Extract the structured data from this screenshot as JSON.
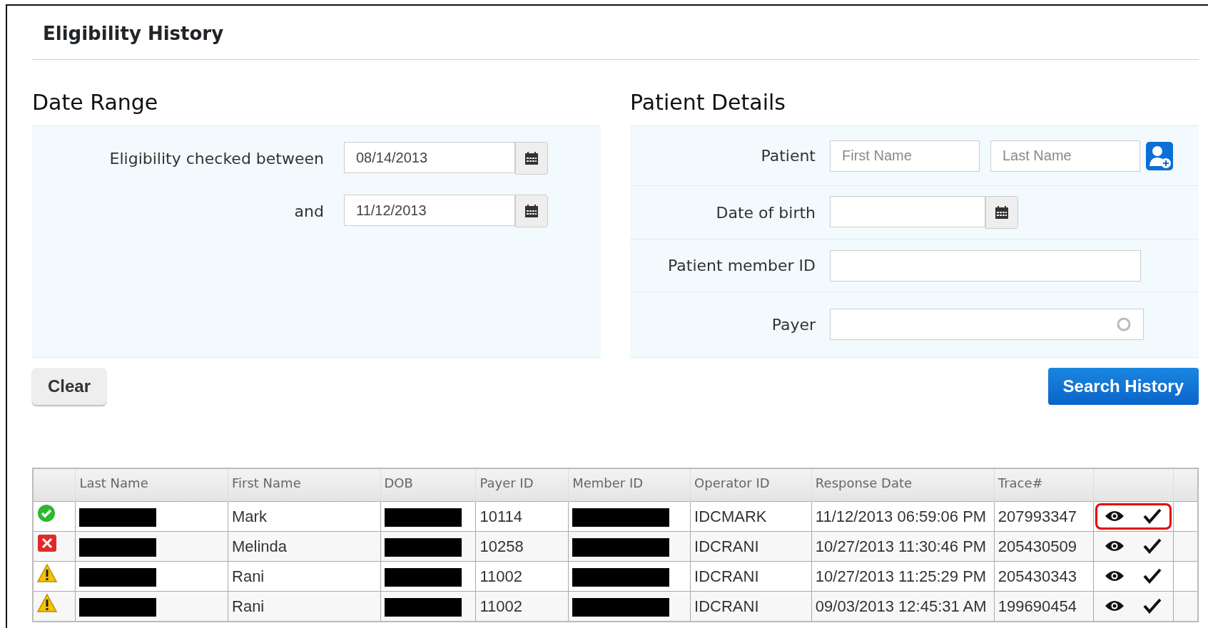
{
  "page": {
    "title": "Eligibility History"
  },
  "date_range": {
    "heading": "Date Range",
    "from_label": "Eligibility checked between",
    "from_value": "08/14/2013",
    "to_label": "and",
    "to_value": "11/12/2013"
  },
  "patient_details": {
    "heading": "Patient Details",
    "patient_label": "Patient",
    "first_name_placeholder": "First Name",
    "last_name_placeholder": "Last Name",
    "dob_label": "Date of birth",
    "member_id_label": "Patient member ID",
    "payer_label": "Payer"
  },
  "buttons": {
    "clear": "Clear",
    "search": "Search History"
  },
  "table": {
    "columns": [
      "Last Name",
      "First Name",
      "DOB",
      "Payer ID",
      "Member ID",
      "Operator ID",
      "Response Date",
      "Trace#"
    ],
    "rows": [
      {
        "kind": "success",
        "first_name": "Mark",
        "payer_id": "10114",
        "operator_id": "IDCMARK",
        "response_date": "11/12/2013 06:59:06 PM",
        "trace": "207993347",
        "highlighted": true
      },
      {
        "kind": "error",
        "first_name": "Melinda",
        "payer_id": "10258",
        "operator_id": "IDCRANI",
        "response_date": "10/27/2013 11:30:46 PM",
        "trace": "205430509",
        "highlighted": false
      },
      {
        "kind": "warning",
        "first_name": "Rani",
        "payer_id": "11002",
        "operator_id": "IDCRANI",
        "response_date": "10/27/2013 11:25:29 PM",
        "trace": "205430343",
        "highlighted": false
      },
      {
        "kind": "warning",
        "first_name": "Rani",
        "payer_id": "11002",
        "operator_id": "IDCRANI",
        "response_date": "09/03/2013 12:45:31 AM",
        "trace": "199690454",
        "highlighted": false
      }
    ]
  }
}
